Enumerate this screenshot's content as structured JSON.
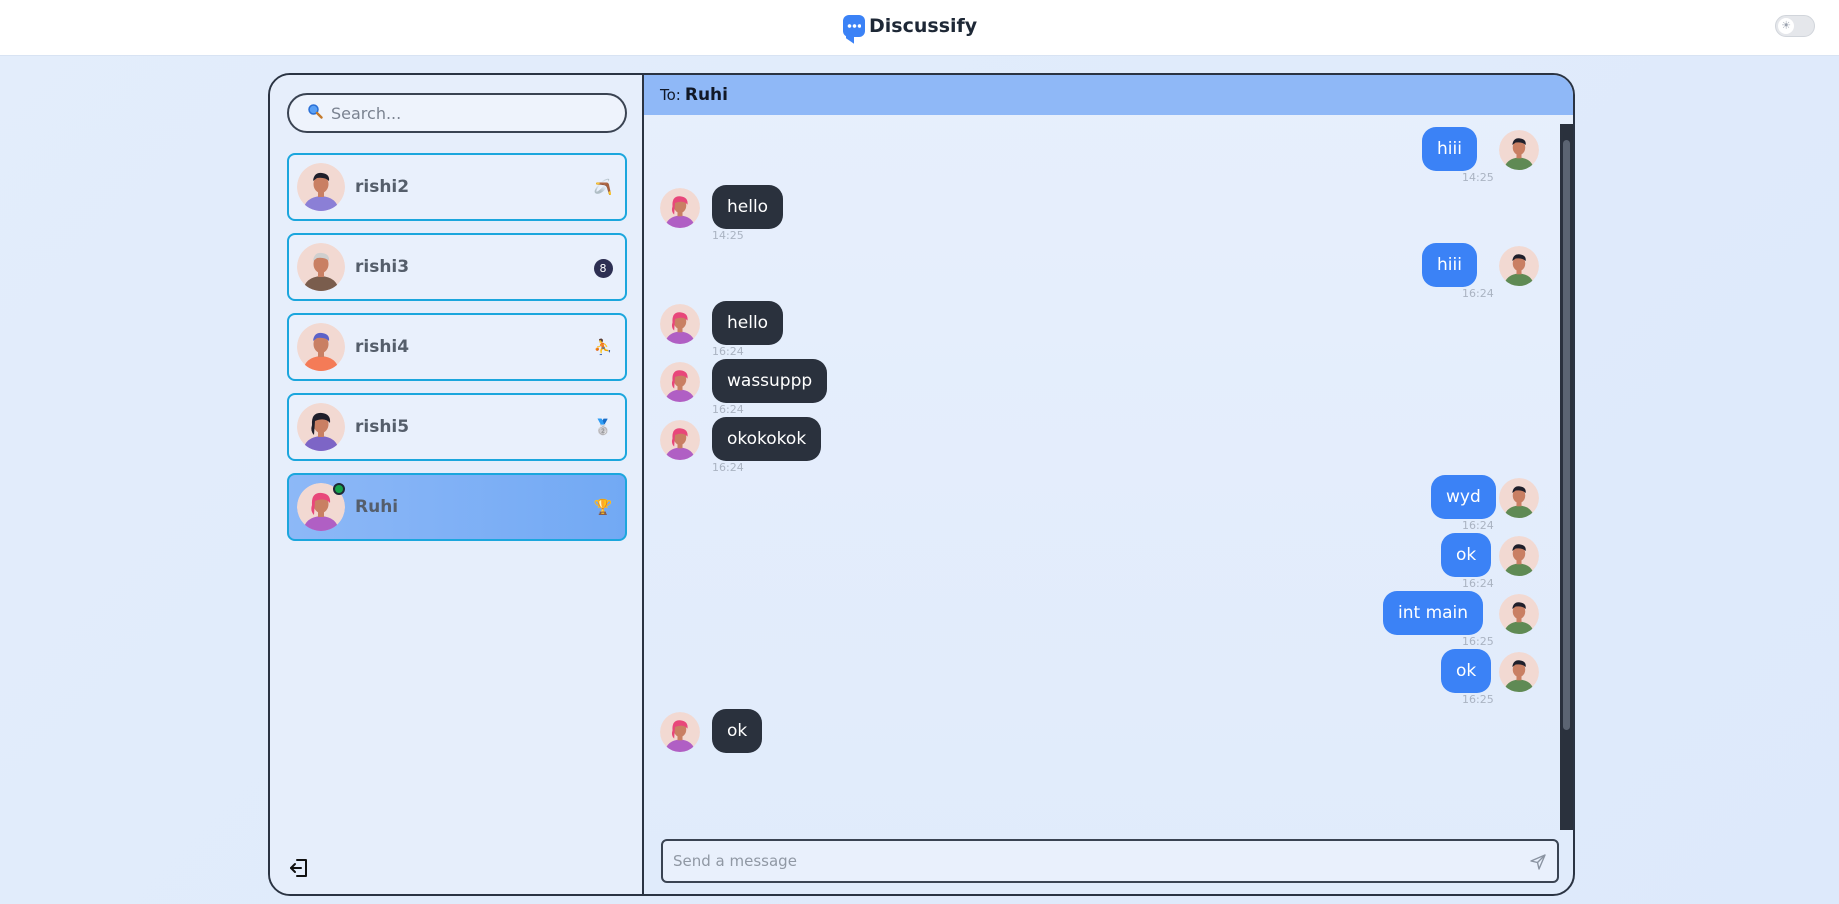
{
  "app": {
    "title": "Discussify"
  },
  "search": {
    "placeholder": "Search..."
  },
  "contacts": [
    {
      "name": "rishi2",
      "badge": "🪃",
      "active": false
    },
    {
      "name": "rishi3",
      "badge": "8",
      "active": false
    },
    {
      "name": "rishi4",
      "badge": "⛹",
      "active": false
    },
    {
      "name": "rishi5",
      "badge": "🥈",
      "active": false
    },
    {
      "name": "Ruhi",
      "badge": "🏆",
      "active": true,
      "online": true
    }
  ],
  "chat": {
    "to_label": "To:",
    "to_name": "Ruhi",
    "messages": [
      {
        "dir": "out",
        "text": "hiii",
        "time": "14:25"
      },
      {
        "dir": "in",
        "text": "hello",
        "time": "14:25"
      },
      {
        "dir": "out",
        "text": "hiii",
        "time": "16:24"
      },
      {
        "dir": "in",
        "text": "hello",
        "time": "16:24"
      },
      {
        "dir": "in",
        "text": "wassuppp",
        "time": "16:24"
      },
      {
        "dir": "in",
        "text": "okokokok",
        "time": "16:24"
      },
      {
        "dir": "out",
        "text": "wyd",
        "time": "16:24"
      },
      {
        "dir": "out",
        "text": "ok",
        "time": "16:24"
      },
      {
        "dir": "out",
        "text": "int main",
        "time": "16:25"
      },
      {
        "dir": "out",
        "text": "ok",
        "time": "16:25"
      },
      {
        "dir": "in",
        "text": "ok",
        "time": ""
      }
    ],
    "composer_placeholder": "Send a message"
  },
  "colors": {
    "accent": "#3b82f6",
    "incoming_bubble": "#2a313d",
    "header_bar": "#8fb8f7",
    "contact_border": "#1ba6dd",
    "online": "#16a34a"
  },
  "icons": {
    "search": "search-icon",
    "logout": "logout-icon",
    "send": "send-icon",
    "theme": "theme-toggle-icon"
  }
}
